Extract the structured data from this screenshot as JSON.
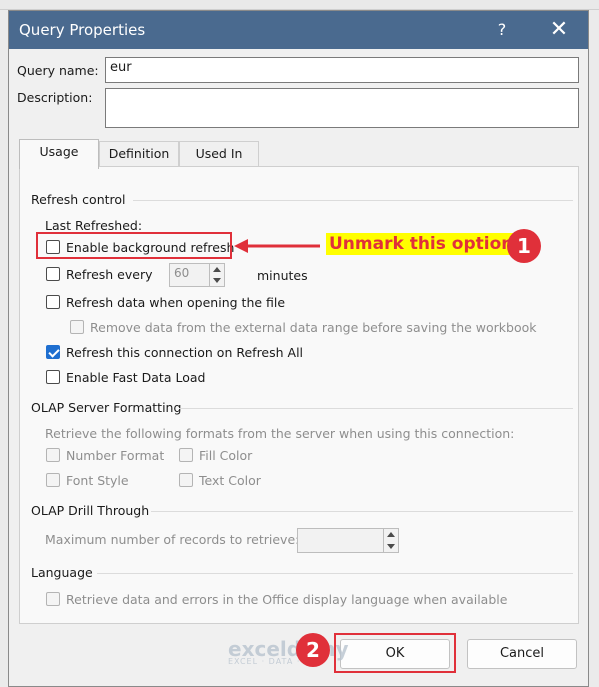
{
  "dialog": {
    "title": "Query Properties",
    "help": "?",
    "close": "✕"
  },
  "fields": {
    "query_name_label": "Query name:",
    "query_name_value": "eur",
    "description_label": "Description:"
  },
  "tabs": [
    {
      "label": "Usage",
      "active": true
    },
    {
      "label": "Definition",
      "active": false
    },
    {
      "label": "Used In",
      "active": false
    }
  ],
  "refresh_control": {
    "title": "Refresh control",
    "last_refreshed": "Last Refreshed:",
    "enable_background": {
      "label": "Enable background refresh",
      "checked": false
    },
    "refresh_every": {
      "label": "Refresh every",
      "value": "60",
      "unit": "minutes",
      "checked": false
    },
    "refresh_on_open": {
      "label": "Refresh data when opening the file",
      "checked": false
    },
    "remove_data": {
      "label": "Remove data from the external data range before saving the workbook",
      "checked": false,
      "disabled": true
    },
    "refresh_all": {
      "label": "Refresh this connection on Refresh All",
      "checked": true
    },
    "fast_load": {
      "label": "Enable Fast Data Load",
      "checked": false
    }
  },
  "olap_formatting": {
    "title": "OLAP Server Formatting",
    "description": "Retrieve the following formats from the server when using this connection:",
    "number_format": "Number Format",
    "fill_color": "Fill Color",
    "font_style": "Font Style",
    "text_color": "Text Color"
  },
  "olap_drill": {
    "title": "OLAP Drill Through",
    "max_records": "Maximum number of records to retrieve:"
  },
  "language": {
    "title": "Language",
    "option": "Retrieve data and errors in the Office display language when available"
  },
  "buttons": {
    "ok": "OK",
    "cancel": "Cancel"
  },
  "annotations": {
    "step1_text": "Unmark this option",
    "step1_badge": "1",
    "step2_badge": "2",
    "color": "#e0303a",
    "highlight": "#ffff00"
  },
  "watermark": {
    "brand": "exceldemy",
    "tagline": "EXCEL · DATA · BI"
  }
}
